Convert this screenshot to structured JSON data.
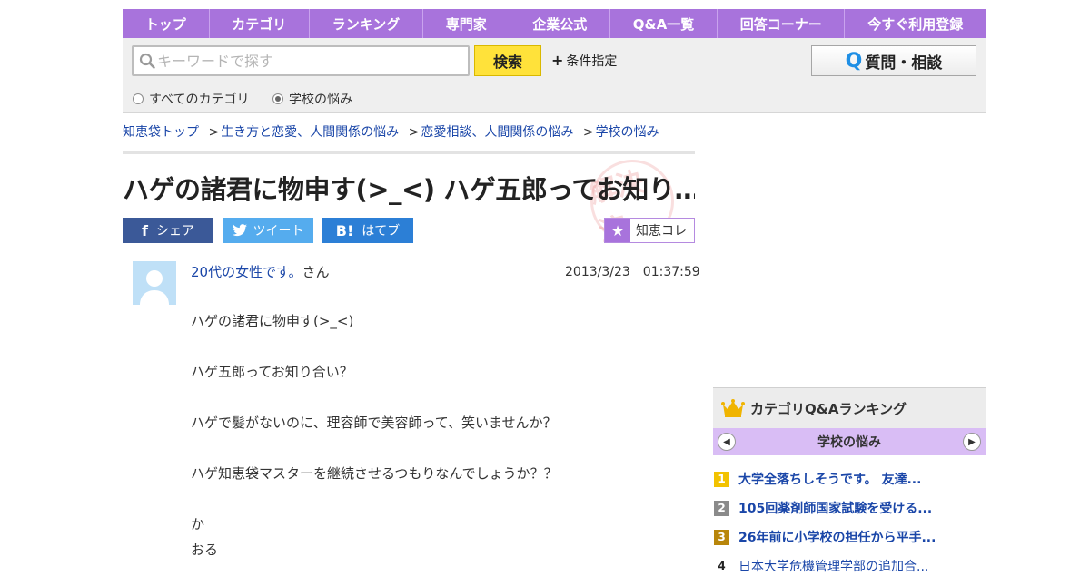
{
  "nav": {
    "items": [
      "トップ",
      "カテゴリ",
      "ランキング",
      "専門家",
      "企業公式",
      "Q&A一覧",
      "回答コーナー",
      "今すぐ利用登録"
    ]
  },
  "search": {
    "placeholder": "キーワードで探す",
    "button_label": "検索",
    "conditions_label": "条件指定",
    "ask_label": "質問・相談",
    "scope_all": "すべてのカテゴリ",
    "scope_current": "学校の悩み",
    "scope_selected": "学校の悩み"
  },
  "breadcrumb": {
    "items": [
      "知恵袋トップ",
      "生き方と恋愛、人間関係の悩み",
      "恋愛相談、人間関係の悩み",
      "学校の悩み"
    ],
    "separator": ">"
  },
  "question": {
    "title": "ハゲの諸君に物申す(>_<) ハゲ五郎ってお知り…",
    "asker_name": "20代の女性です。",
    "asker_suffix": "さん",
    "date": "2013/3/23　01:37:59",
    "body_lines": [
      "ハゲの諸君に物申す(>_<)",
      "",
      "ハゲ五郎ってお知り合い？",
      "",
      "ハゲで髪がないのに、理容師で美容師って、笑いませんか？",
      "",
      "ハゲ知恵袋マスターを継続させるつもりなんでしょうか？？",
      "",
      "か",
      "おる"
    ]
  },
  "share": {
    "facebook_label": "シェア",
    "twitter_label": "ツイート",
    "hatena_label": "はてブ",
    "chiecolle_label": "知恵コレ",
    "stamp_text": "解決済"
  },
  "ranking": {
    "title": "カテゴリQ&Aランキング",
    "category": "学校の悩み",
    "items": [
      {
        "rank": "1",
        "text": "大学全落ちしそうです。 友達...",
        "color": "#f2c200"
      },
      {
        "rank": "2",
        "text": "105回薬剤師国家試験を受ける...",
        "color": "#8a8a8a"
      },
      {
        "rank": "3",
        "text": "26年前に小学校の担任から平手...",
        "color": "#b8860b"
      },
      {
        "rank": "4",
        "text": "日本大学危機管理学部の追加合...",
        "color": ""
      }
    ]
  },
  "colors": {
    "accent": "#a873dc",
    "search_button": "#ffe23a",
    "link": "#1a46a8",
    "facebook": "#3b5998",
    "twitter": "#55acee",
    "hatena": "#2c7fd6"
  }
}
